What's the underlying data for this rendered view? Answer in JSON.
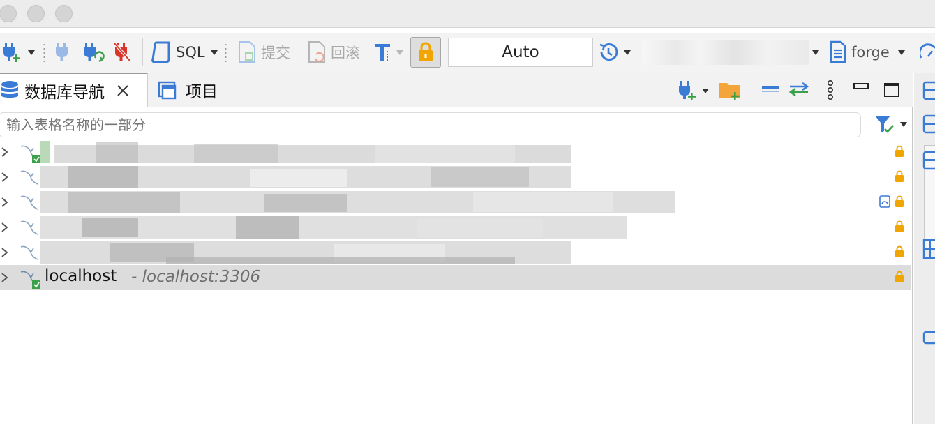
{
  "toolbar": {
    "sql_label": "SQL",
    "commit_label": "提交",
    "rollback_label": "回滚",
    "transaction_mode": "Auto",
    "schema_label": "forge"
  },
  "tabs": [
    {
      "label": "数据库导航",
      "active": true
    },
    {
      "label": "项目",
      "active": false
    }
  ],
  "filter": {
    "placeholder": "输入表格名称的一部分"
  },
  "connections": [
    {
      "name": "",
      "masked": true,
      "locked": true
    },
    {
      "name": "",
      "masked": true,
      "locked": true
    },
    {
      "name": "",
      "masked": true,
      "locked": true,
      "network_icon": true
    },
    {
      "name": "",
      "masked": true,
      "locked": true
    },
    {
      "name": "",
      "masked": true,
      "locked": true
    },
    {
      "name": "localhost",
      "description": "- localhost:3306",
      "masked": false,
      "locked": true,
      "selected": true
    }
  ],
  "colors": {
    "accent_blue": "#3a7bd5",
    "lock_orange": "#f0a500",
    "disconnect_red": "#d9362b",
    "connect_green": "#3aa14a",
    "selection_bg": "#dcdcdc"
  }
}
